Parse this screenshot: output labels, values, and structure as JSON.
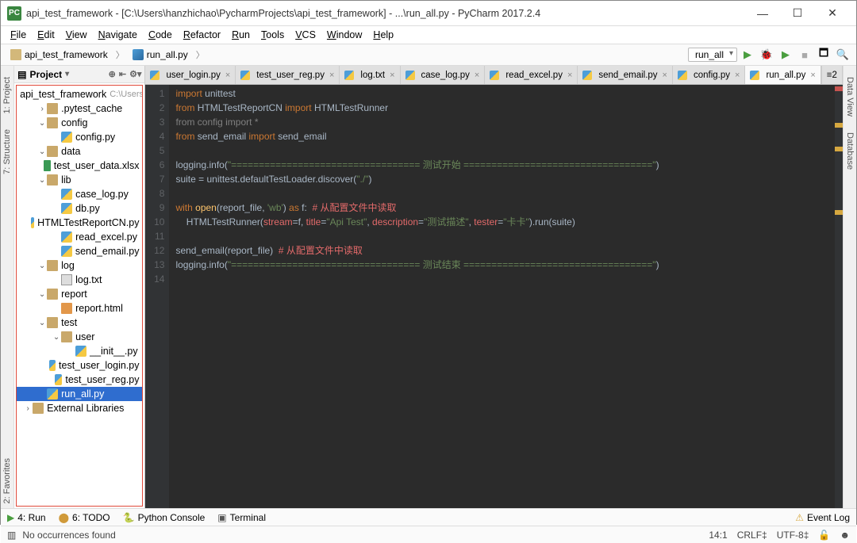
{
  "window": {
    "title": "api_test_framework - [C:\\Users\\hanzhichao\\PycharmProjects\\api_test_framework] - ...\\run_all.py - PyCharm 2017.2.4",
    "icon": "PC"
  },
  "menu": [
    "File",
    "Edit",
    "View",
    "Navigate",
    "Code",
    "Refactor",
    "Run",
    "Tools",
    "VCS",
    "Window",
    "Help"
  ],
  "breadcrumb": {
    "root": "api_test_framework",
    "file": "run_all.py"
  },
  "run_config": "run_all",
  "left_tabs": [
    "1: Project",
    "7: Structure"
  ],
  "fav_tab": "2: Favorites",
  "right_tabs": [
    "Data View",
    "Database"
  ],
  "project_panel": {
    "title": "Project",
    "root": "api_test_framework",
    "root_path": "C:\\Users\\ha",
    "tree": [
      {
        "d": 0,
        "exp": true,
        "t": "dir",
        "label": "api_test_framework",
        "suffix": "C:\\Users\\ha"
      },
      {
        "d": 1,
        "exp": false,
        "arrow": ">",
        "t": "dir",
        "label": ".pytest_cache"
      },
      {
        "d": 1,
        "exp": true,
        "arrow": "v",
        "t": "dir",
        "label": "config"
      },
      {
        "d": 2,
        "t": "py",
        "label": "config.py"
      },
      {
        "d": 1,
        "exp": true,
        "arrow": "v",
        "t": "dir",
        "label": "data"
      },
      {
        "d": 2,
        "t": "xl",
        "label": "test_user_data.xlsx"
      },
      {
        "d": 1,
        "exp": true,
        "arrow": "v",
        "t": "dir",
        "label": "lib"
      },
      {
        "d": 2,
        "t": "py",
        "label": "case_log.py"
      },
      {
        "d": 2,
        "t": "py",
        "label": "db.py"
      },
      {
        "d": 2,
        "t": "py",
        "label": "HTMLTestReportCN.py"
      },
      {
        "d": 2,
        "t": "py",
        "label": "read_excel.py"
      },
      {
        "d": 2,
        "t": "py",
        "label": "send_email.py"
      },
      {
        "d": 1,
        "exp": true,
        "arrow": "v",
        "t": "dir",
        "label": "log"
      },
      {
        "d": 2,
        "t": "txt",
        "label": "log.txt"
      },
      {
        "d": 1,
        "exp": true,
        "arrow": "v",
        "t": "dir",
        "label": "report"
      },
      {
        "d": 2,
        "t": "html",
        "label": "report.html"
      },
      {
        "d": 1,
        "exp": true,
        "arrow": "v",
        "t": "dir",
        "label": "test"
      },
      {
        "d": 2,
        "exp": true,
        "arrow": "v",
        "t": "dir",
        "label": "user"
      },
      {
        "d": 3,
        "t": "py",
        "label": "__init__.py"
      },
      {
        "d": 3,
        "t": "py",
        "label": "test_user_login.py"
      },
      {
        "d": 3,
        "t": "py",
        "label": "test_user_reg.py"
      },
      {
        "d": 1,
        "t": "py",
        "label": "run_all.py",
        "sel": true
      },
      {
        "d": 0,
        "exp": false,
        "arrow": ">",
        "t": "lib",
        "label": "External Libraries"
      }
    ]
  },
  "editor_tabs": [
    {
      "label": "user_login.py",
      "icon": "py"
    },
    {
      "label": "test_user_reg.py",
      "icon": "py"
    },
    {
      "label": "log.txt",
      "icon": "txt"
    },
    {
      "label": "case_log.py",
      "icon": "py"
    },
    {
      "label": "read_excel.py",
      "icon": "py"
    },
    {
      "label": "send_email.py",
      "icon": "py"
    },
    {
      "label": "config.py",
      "icon": "py"
    },
    {
      "label": "run_all.py",
      "icon": "py",
      "active": true
    }
  ],
  "tabs_overflow": "≡2",
  "code": {
    "lines": [
      {
        "n": 1,
        "seg": [
          {
            "c": "kw",
            "t": "import "
          },
          {
            "c": "",
            "t": "unittest"
          }
        ]
      },
      {
        "n": 2,
        "seg": [
          {
            "c": "kw",
            "t": "from "
          },
          {
            "c": "",
            "t": "HTMLTestReportCN "
          },
          {
            "c": "kw",
            "t": "import "
          },
          {
            "c": "",
            "t": "HTMLTestRunner"
          }
        ]
      },
      {
        "n": 3,
        "seg": [
          {
            "c": "cmt2",
            "t": "from config import *"
          }
        ]
      },
      {
        "n": 4,
        "seg": [
          {
            "c": "kw",
            "t": "from "
          },
          {
            "c": "",
            "t": "send_email "
          },
          {
            "c": "kw",
            "t": "import "
          },
          {
            "c": "",
            "t": "send_email"
          }
        ]
      },
      {
        "n": 5,
        "seg": [
          {
            "c": "",
            "t": ""
          }
        ]
      },
      {
        "n": 6,
        "seg": [
          {
            "c": "",
            "t": "logging.info("
          },
          {
            "c": "str",
            "t": "\"================================== 测试开始 ==================================\""
          },
          {
            "c": "",
            "t": ")"
          }
        ]
      },
      {
        "n": 7,
        "seg": [
          {
            "c": "",
            "t": "suite = unittest.defaultTestLoader.discover("
          },
          {
            "c": "str",
            "t": "\"./\""
          },
          {
            "c": "",
            "t": ")"
          }
        ]
      },
      {
        "n": 8,
        "seg": [
          {
            "c": "",
            "t": ""
          }
        ]
      },
      {
        "n": 9,
        "seg": [
          {
            "c": "kw",
            "t": "with "
          },
          {
            "c": "fn",
            "t": "open"
          },
          {
            "c": "",
            "t": "(report_file, "
          },
          {
            "c": "str",
            "t": "'wb'"
          },
          {
            "c": "",
            "t": ") "
          },
          {
            "c": "kw",
            "t": "as"
          },
          {
            "c": "",
            "t": " f:  "
          },
          {
            "c": "red",
            "t": "# 从配置文件中读取"
          }
        ]
      },
      {
        "n": 10,
        "seg": [
          {
            "c": "",
            "t": "    HTMLTestRunner("
          },
          {
            "c": "red",
            "t": "stream"
          },
          {
            "c": "",
            "t": "=f, "
          },
          {
            "c": "red",
            "t": "title"
          },
          {
            "c": "",
            "t": "="
          },
          {
            "c": "str",
            "t": "\"Api Test\""
          },
          {
            "c": "",
            "t": ", "
          },
          {
            "c": "red",
            "t": "description"
          },
          {
            "c": "",
            "t": "="
          },
          {
            "c": "str",
            "t": "\"测试描述\""
          },
          {
            "c": "",
            "t": ", "
          },
          {
            "c": "red",
            "t": "tester"
          },
          {
            "c": "",
            "t": "="
          },
          {
            "c": "str",
            "t": "\"卡卡\""
          },
          {
            "c": "",
            "t": ").run(suite)"
          }
        ]
      },
      {
        "n": 11,
        "seg": [
          {
            "c": "",
            "t": ""
          }
        ]
      },
      {
        "n": 12,
        "seg": [
          {
            "c": "",
            "t": "send_email(report_file)  "
          },
          {
            "c": "red",
            "t": "# 从配置文件中读取"
          }
        ]
      },
      {
        "n": 13,
        "seg": [
          {
            "c": "",
            "t": "logging.info("
          },
          {
            "c": "str",
            "t": "\"================================== 测试结束 ==================================\""
          },
          {
            "c": "",
            "t": ")"
          }
        ]
      },
      {
        "n": 14,
        "seg": [
          {
            "c": "",
            "t": ""
          }
        ]
      }
    ]
  },
  "bottom_buttons": [
    {
      "icon": "▶",
      "label": "4: Run",
      "color": "#4a9e3f"
    },
    {
      "icon": "⬤",
      "label": "6: TODO",
      "color": "#d09a3a"
    },
    {
      "icon": "🐍",
      "label": "Python Console",
      "color": "#4a9e3f"
    },
    {
      "icon": "▣",
      "label": "Terminal",
      "color": "#555"
    }
  ],
  "event_log": "Event Log",
  "status": {
    "msg": "No occurrences found",
    "pos": "14:1",
    "lineend": "CRLF‡",
    "enc": "UTF-8‡",
    "lock": "⎆"
  }
}
